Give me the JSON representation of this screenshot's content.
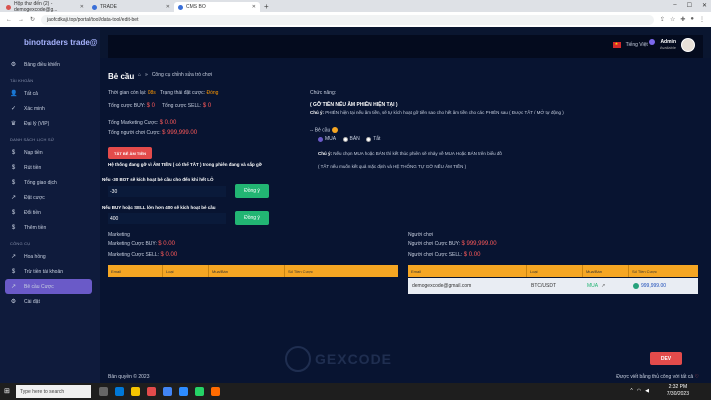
{
  "browser": {
    "tabs": [
      {
        "label": "Hộp thư đến (2) - demogexcode@g..."
      },
      {
        "label": "TRADE"
      },
      {
        "label": "CMS BO"
      }
    ],
    "url": "jaofcdkaji.top/portal/tool/data-tool/edit-bet"
  },
  "sidebar": {
    "brand": "binotraders trade@",
    "dashboard": "Bảng điều khiển",
    "sec_account": "TÀI KHOẢN",
    "account_items": [
      {
        "label": "Tất cả",
        "icon": "user-icon"
      },
      {
        "label": "Xác minh",
        "icon": "check-icon"
      },
      {
        "label": "Đại lý (VIP)",
        "icon": "crown-icon"
      }
    ],
    "sec_history": "DANH SÁCH LỊCH SỬ",
    "history_items": [
      {
        "label": "Nạp tiền",
        "icon": "dollar-icon"
      },
      {
        "label": "Rút tiền",
        "icon": "dollar-icon"
      },
      {
        "label": "Tổng giao dịch",
        "icon": "dollar-icon"
      },
      {
        "label": "Đặt cược",
        "icon": "trend-icon"
      },
      {
        "label": "Đổi tiền",
        "icon": "dollar-icon"
      },
      {
        "label": "Thêm tiền",
        "icon": "dollar-icon"
      }
    ],
    "sec_tools": "CÔNG CỤ",
    "tool_items": [
      {
        "label": "Hoa hồng",
        "icon": "trend-icon"
      },
      {
        "label": "Trừ tiền tài khoản",
        "icon": "dollar-icon"
      },
      {
        "label": "Bẻ cầu Cược",
        "icon": "trend-icon"
      },
      {
        "label": "Cài đặt",
        "icon": "gear-icon"
      }
    ]
  },
  "topbar": {
    "lang": "Tiếng Việt",
    "user_name": "Admin",
    "user_status": "Available"
  },
  "page": {
    "title": "Bẻ cầu",
    "breadcrumb": "Công cụ chỉnh sửa trò chơi"
  },
  "left": {
    "time_label": "Thời gian còn lại:",
    "time_value": "08s",
    "status_label": "Trạng thái đặt cược:",
    "status_value": "Đóng",
    "buy_label": "Tổng cược BUY:",
    "buy_value": "$ 0",
    "sell_label": "Tổng cược SELL:",
    "sell_value": "$ 0",
    "mkt_label": "Tổng Marketing Cược:",
    "mkt_value": "$ 0.00",
    "players_label": "Tổng người chơi Cược:",
    "players_value": "$ 999,999.00",
    "off_button": "TẮT BẺ ÂM TIỀN",
    "note": "Hệ thống đang gỡ vì ÂM TIỀN ( có thể TẮT ) trong phiên đang và sắp gỡ",
    "rule1_label": "Nếu -30 BOT sẽ kích hoạt bẻ cầu cho đến khi hết LỖ",
    "rule1_value": "-30",
    "rule2_label": "Nếu BUY hoặc SELL lớn hơn 400 sẽ kích hoạt bẻ cầu",
    "rule2_value": "400",
    "save_label": "Đồng ý"
  },
  "right": {
    "func_label": "Chức năng:",
    "func_title": "( GỠ TIỀN NẾU ÂM PHIÊN HIỆN TẠI )",
    "func_note_prefix": "Chú ý:",
    "func_note": "PHIÊN hiện tại nếu âm tiền, sẽ tự kích hoạt gỡ tiền sao cho hết âm tiền cho các PHIÊN sau ( Được TẮT / MỞ tự động )",
    "pick_label": "-- Bẻ cầu",
    "opt_buy": "MUA",
    "opt_sell": "BÁN",
    "opt_off": "Tắt",
    "note2_prefix": "Chú ý:",
    "note2": "Nếu chọn MUA hoặc BÁN thì kết thúc phiên sẽ nhảy về MUA Hoặc BÁN trên biểu đồ",
    "note3": "( TẮT nếu muốn kết quả mặc định và HỆ THỐNG TỰ GỠ NẾU ÂM TIỀN )"
  },
  "marketing": {
    "title": "Marketing",
    "buy_label": "Marketing Cược BUY:",
    "buy_value": "$ 0.00",
    "sell_label": "Marketing Cược SELL:",
    "sell_value": "$ 0.00",
    "columns": [
      "Email",
      "Loại",
      "Mua/Bán",
      "Số Tiền Cược"
    ]
  },
  "players": {
    "title": "Người chơi",
    "buy_label": "Người chơi Cược BUY:",
    "buy_value": "$ 999,999.00",
    "sell_label": "Người chơi Cược SELL:",
    "sell_value": "$ 0.00",
    "columns": [
      "Email",
      "Loại",
      "Mua/Bán",
      "Số Tiền Cược"
    ],
    "row": {
      "email": "demogexcode@gmail.com",
      "type": "BTC/USDT",
      "side": "MUA",
      "amount": "999,999.00"
    }
  },
  "watermark": "GEXCODE",
  "dev_button": "DEV",
  "footer": {
    "copyright": "Bản quyền © 2023",
    "credit": "Được viết bằng thủ công với tất cả"
  },
  "taskbar": {
    "search": "Type here to search",
    "time": "2:32 PM",
    "date": "7/30/2023"
  },
  "colors": {
    "accent": "#6a5ac8",
    "danger": "#e34b4b",
    "success": "#22b573",
    "table_header": "#f5a623"
  }
}
